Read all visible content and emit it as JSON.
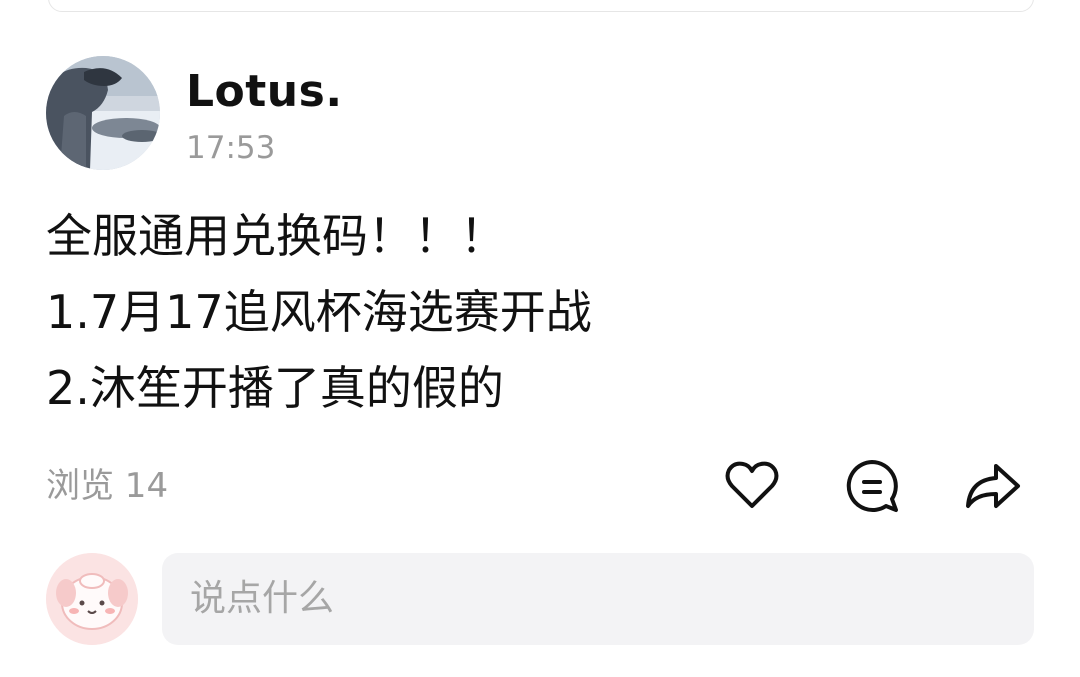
{
  "post": {
    "author": "Lotus.",
    "time": "17:53",
    "lines": [
      "全服通用兑换码！！！",
      "1.7月17追风杯海选赛开战",
      "2.沐笙开播了真的假的"
    ]
  },
  "stats": {
    "views_text": "浏览 14"
  },
  "actions": {
    "like_icon": "heart-icon",
    "comment_icon": "comment-bubble-icon",
    "share_icon": "share-arrow-icon"
  },
  "comment": {
    "placeholder": "说点什么"
  },
  "colors": {
    "text_primary": "#111111",
    "text_secondary": "#9a9a9a",
    "input_bg": "#f3f3f5",
    "avatar_pink": "#fbe6e6"
  }
}
